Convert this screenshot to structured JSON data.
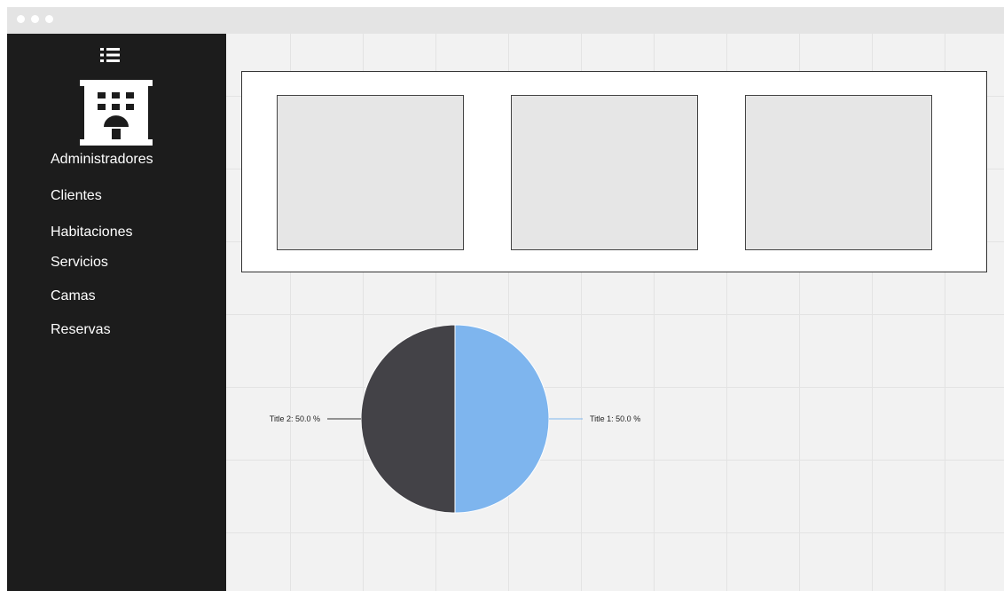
{
  "sidebar": {
    "menu_icon": "menu-list-icon",
    "logo_icon": "hotel-building-icon",
    "items": [
      {
        "label": "Administradores"
      },
      {
        "label": "Clientes"
      },
      {
        "label": "Habitaciones"
      },
      {
        "label": "Servicios"
      },
      {
        "label": "Camas"
      },
      {
        "label": "Reservas"
      }
    ]
  },
  "main": {
    "cards": [
      {
        "name": "card-1"
      },
      {
        "name": "card-2"
      },
      {
        "name": "card-3"
      }
    ]
  },
  "chart_data": {
    "type": "pie",
    "series": [
      {
        "label": "Title 1: 50.0 %",
        "value": 50.0,
        "color": "#7eb5ee"
      },
      {
        "label": "Title 2: 50.0 %",
        "value": 50.0,
        "color": "#434247"
      }
    ]
  },
  "colors": {
    "sidebar_bg": "#1c1c1c",
    "titlebar_bg": "#e4e4e4",
    "content_bg": "#f2f2f2",
    "pie_slice_1": "#7eb5ee",
    "pie_slice_2": "#434247"
  }
}
